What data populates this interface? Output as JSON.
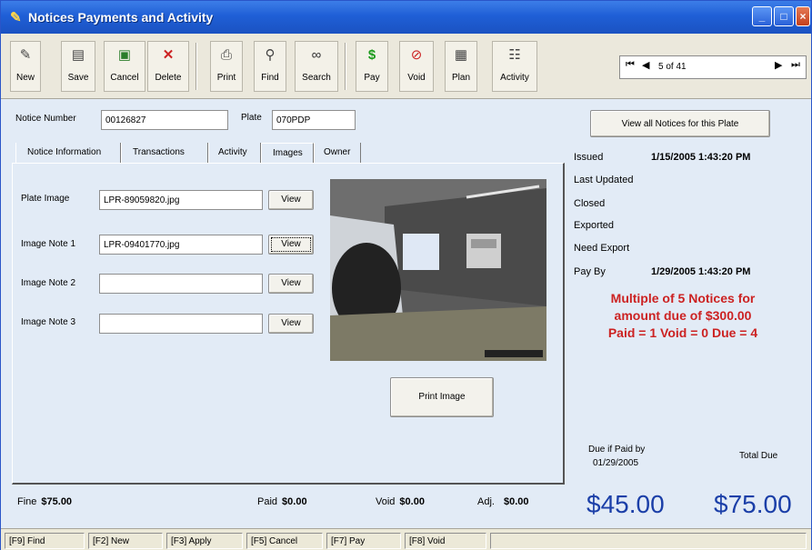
{
  "window": {
    "title": "Notices Payments and Activity"
  },
  "toolbar": {
    "buttons": [
      {
        "label": "New",
        "icon": "new-icon"
      },
      {
        "label": "Save",
        "icon": "save-icon"
      },
      {
        "label": "Cancel",
        "icon": "cancel-icon"
      },
      {
        "label": "Delete",
        "icon": "delete-icon"
      },
      {
        "label": "Print",
        "icon": "printer-icon"
      },
      {
        "label": "Find",
        "icon": "magnifier-icon"
      },
      {
        "label": "Search",
        "icon": "binoculars-icon"
      },
      {
        "label": "Pay",
        "icon": "dollar-icon"
      },
      {
        "label": "Void",
        "icon": "void-icon"
      },
      {
        "label": "Plan",
        "icon": "plan-icon"
      },
      {
        "label": "Activity",
        "icon": "activity-icon"
      }
    ]
  },
  "navigator": {
    "record_text": "5 of 41"
  },
  "header": {
    "notice_number_label": "Notice Number",
    "notice_number_value": "00126827",
    "plate_label": "Plate",
    "plate_value": "070PDP",
    "view_all_button": "View all Notices for this Plate"
  },
  "tabs": [
    {
      "label": "Notice Information"
    },
    {
      "label": "Transactions"
    },
    {
      "label": "Activity"
    },
    {
      "label": "Images",
      "active": true
    },
    {
      "label": "Owner"
    }
  ],
  "images_tab": {
    "rows": [
      {
        "label": "Plate Image",
        "value": "LPR-89059820.jpg",
        "button": "View"
      },
      {
        "label": "Image Note 1",
        "value": "LPR-09401770.jpg",
        "button": "View"
      },
      {
        "label": "Image Note 2",
        "value": "",
        "button": "View"
      },
      {
        "label": "Image Note 3",
        "value": "",
        "button": "View"
      }
    ],
    "print_image_button": "Print Image"
  },
  "status_panel": {
    "issued_label": "Issued",
    "issued_value": "1/15/2005 1:43:20 PM",
    "last_updated_label": "Last Updated",
    "closed_label": "Closed",
    "exported_label": "Exported",
    "need_export_label": "Need Export",
    "pay_by_label": "Pay By",
    "pay_by_value": "1/29/2005 1:43:20 PM",
    "multiple_line1": "Multiple of 5 Notices for",
    "multiple_line2": "amount due of $300.00",
    "multiple_line3": "Paid = 1 Void = 0 Due = 4",
    "due_if_paid_label": "Due if Paid by",
    "due_if_paid_date": "01/29/2005",
    "total_due_label": "Total Due",
    "due_if_paid_amount": "$45.00",
    "total_due_amount": "$75.00"
  },
  "totals": {
    "fine_label": "Fine",
    "fine_value": "$75.00",
    "paid_label": "Paid",
    "paid_value": "$0.00",
    "void_label": "Void",
    "void_value": "$0.00",
    "adj_label": "Adj.",
    "adj_value": "$0.00"
  },
  "statusbar": {
    "keys": [
      "[F9] Find",
      "[F2] New",
      "[F3] Apply",
      "[F5] Cancel",
      "[F7] Pay",
      "[F8] Void",
      ""
    ]
  },
  "colors": {
    "title_bar": "#1f5fd6",
    "alert_red": "#cc2222",
    "amount_blue": "#1b3fa8"
  }
}
